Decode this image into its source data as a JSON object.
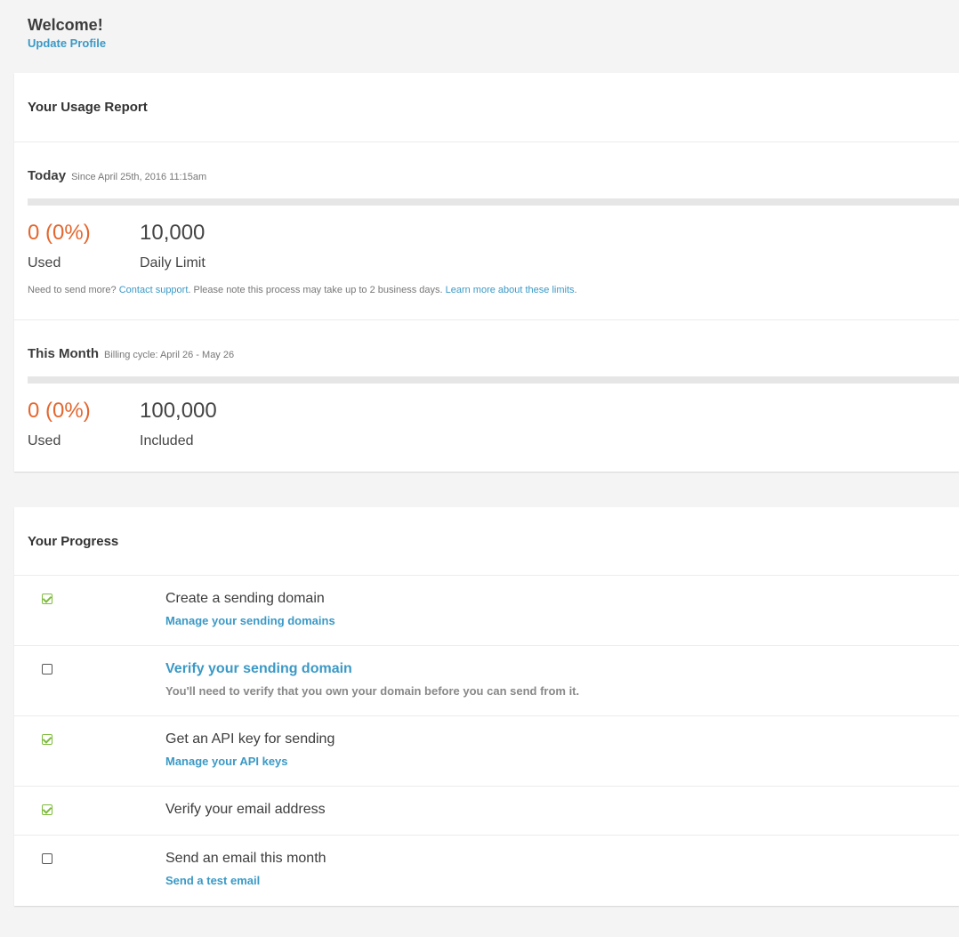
{
  "welcome": {
    "title": "Welcome!",
    "update_profile": "Update Profile"
  },
  "usage": {
    "header": "Your Usage Report",
    "today": {
      "label": "Today",
      "since": "Since April 25th, 2016 11:15am",
      "used_fraction": 0,
      "used_value": "0 (0%)",
      "used_label": "Used",
      "limit_value": "10,000",
      "limit_label": "Daily Limit",
      "note_prefix": "Need to send more?",
      "note_contact": "Contact support",
      "note_middle": ". Please note this process may take up to 2 business days.",
      "note_learn": "Learn more about these limits",
      "note_suffix": "."
    },
    "month": {
      "label": "This Month",
      "billing": "Billing cycle: April 26 - May 26",
      "used_fraction": 0,
      "used_value": "0 (0%)",
      "used_label": "Used",
      "included_value": "100,000",
      "included_label": "Included"
    }
  },
  "progress": {
    "header": "Your Progress",
    "tasks": [
      {
        "checked": true,
        "title": "Create a sending domain",
        "sub": "Manage your sending domains"
      },
      {
        "checked": false,
        "title": "Verify your sending domain",
        "sub": "You'll need to verify that you own your domain before you can send from it."
      },
      {
        "checked": true,
        "title": "Get an API key for sending",
        "sub": "Manage your API keys"
      },
      {
        "checked": true,
        "title": "Verify your email address",
        "sub": ""
      },
      {
        "checked": false,
        "title": "Send an email this month",
        "sub": "Send a test email"
      }
    ]
  },
  "colors": {
    "accent_link": "#3a99c6",
    "used_orange": "#e4672f",
    "check_green": "#7dbb3c"
  }
}
